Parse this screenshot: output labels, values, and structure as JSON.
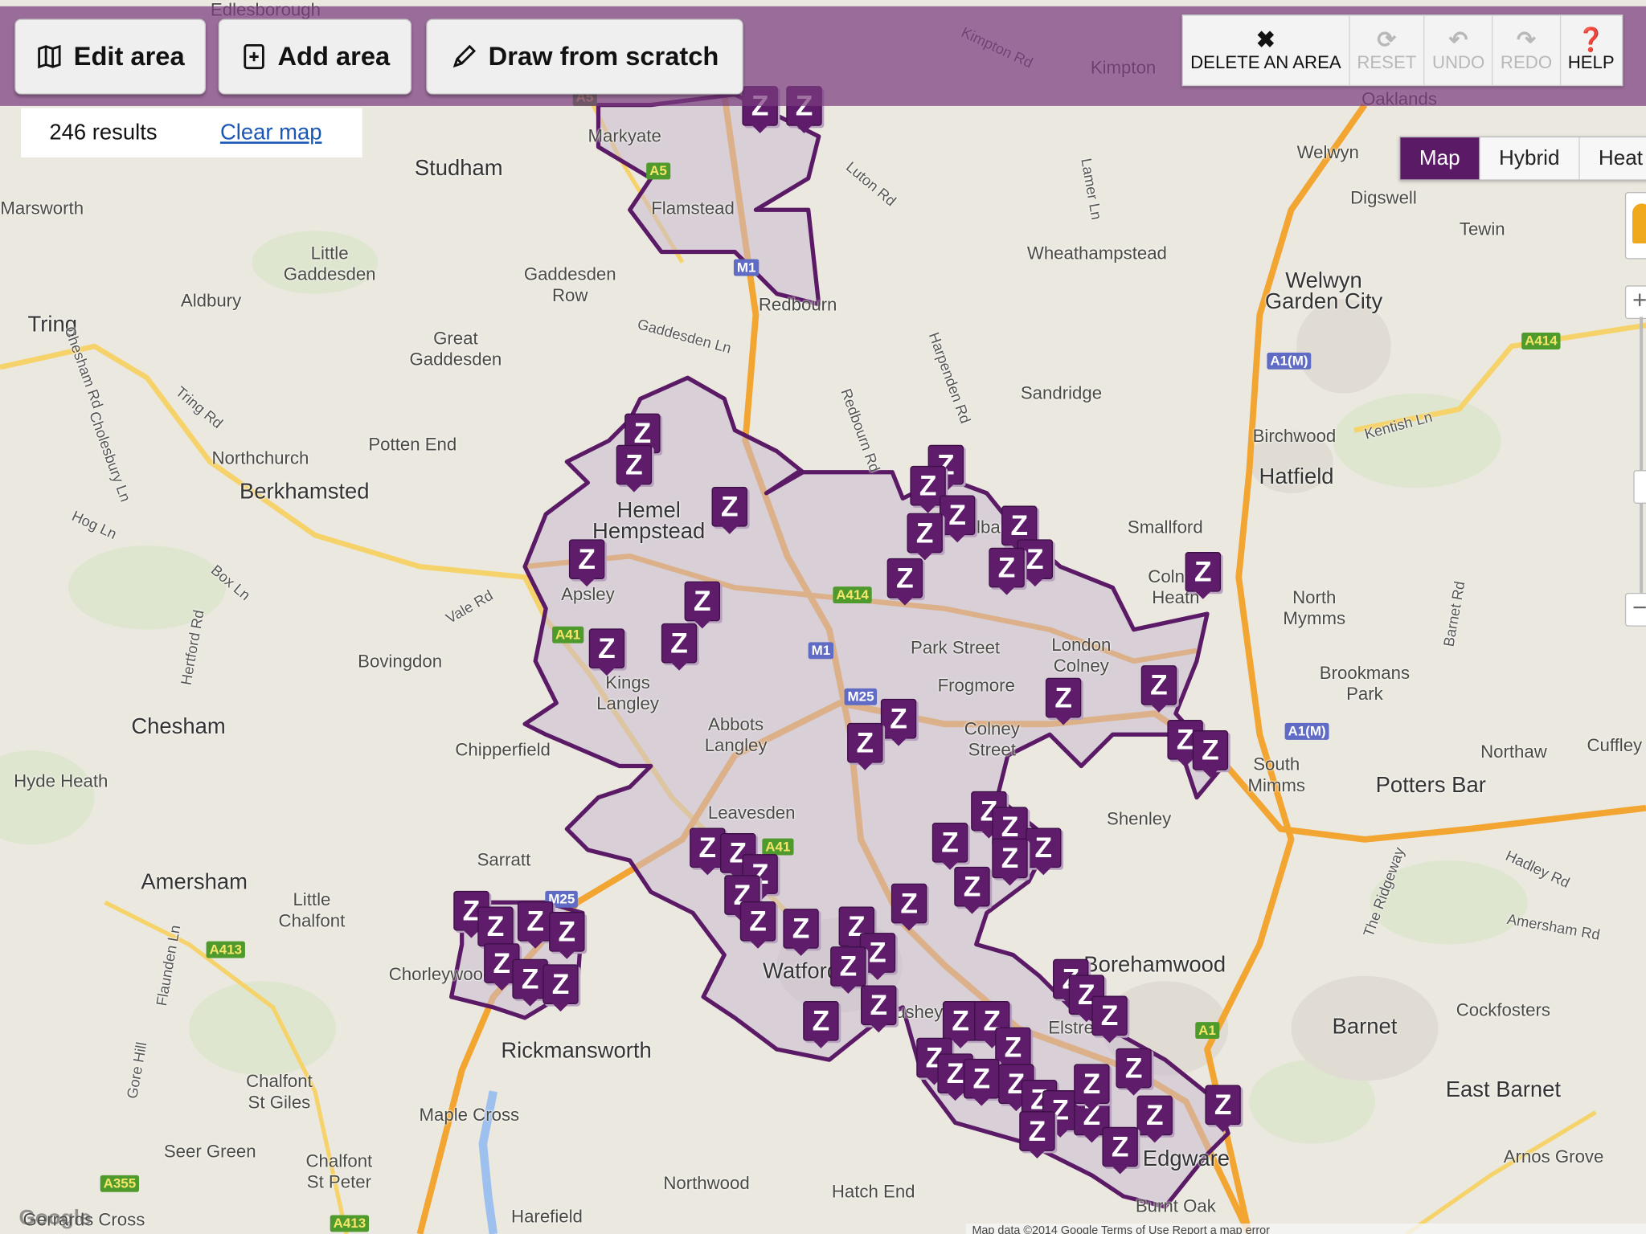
{
  "toolbar": {
    "edit_area": "Edit area",
    "add_area": "Add area",
    "draw_from_scratch": "Draw from scratch",
    "delete_area": "DELETE AN AREA",
    "reset": "RESET",
    "undo": "UNDO",
    "redo": "REDO",
    "help": "HELP",
    "icons": {
      "edit": "map-icon",
      "add": "plus-square-icon",
      "draw": "pencil-icon",
      "delete": "x-icon",
      "reset": "refresh-icon",
      "undo": "undo-icon",
      "redo": "redo-icon",
      "help": "question-circle-icon"
    }
  },
  "results": {
    "count": "246 results",
    "clear": "Clear map"
  },
  "map_type": {
    "options": [
      "Map",
      "Hybrid",
      "Heat"
    ],
    "selected": "Map"
  },
  "zoom_controls": {
    "in": "+",
    "out": "−"
  },
  "colors": {
    "brand": "#5a1a66",
    "toolbar_overlay": "#7a3c7e",
    "area_fill": "#c9b9cf",
    "area_stroke": "#5a1a66",
    "motorway": "#f3a531",
    "a_road": "#f6d36a"
  },
  "markers": {
    "label": "Z"
  },
  "map": {
    "labels": [
      "Edlesborough",
      "Marsworth",
      "Markyate",
      "Studham",
      "Flamstead",
      "Little\nGaddesden",
      "Aldbury",
      "Tring",
      "Gaddesden\nRow",
      "Redbourn",
      "Great\nGaddesden",
      "Potten End",
      "Northchurch",
      "Berkhamsted",
      "Hemel\nHempstead",
      "Apsley",
      "Bovingdon",
      "Kings\nLangley",
      "Chesham",
      "Chipperfield",
      "Abbots\nLangley",
      "Hyde Heath",
      "Leavesden",
      "Sarratt",
      "Amersham",
      "Little\nChalfont",
      "Chorleywood",
      "Watford",
      "Rickmansworth",
      "Maple Cross",
      "Chalfont\nSt Giles",
      "Seer Green",
      "Chalfont\nSt Peter",
      "Northwood",
      "Hatch End",
      "Harefield",
      "Gerrards Cross",
      "Kimpton",
      "Oaklands",
      "Welwyn",
      "Digswell",
      "Tewin",
      "Wheathampstead",
      "Welwyn\nGarden City",
      "Sandridge",
      "Birchwood",
      "Hatfield",
      "Smallford",
      "Colney\nHeath",
      "North\nMymms",
      "London\nColney",
      "Park Street",
      "Frogmore",
      "Colney\nStreet",
      "Brookmans\nPark",
      "South\nMimms",
      "Potters Bar",
      "Northaw",
      "Cuffley",
      "Shenley",
      "Borehamwood",
      "Elstree",
      "Bushey",
      "Barnet",
      "Cockfosters",
      "East Barnet",
      "Edgware",
      "Arnos Grove",
      "Burnt Oak",
      "St Albans"
    ],
    "roads": [
      "Kimpton Rd",
      "Luton Rd",
      "Lamer Ln",
      "Gaddesden Ln",
      "Redbourn Rd",
      "Harpenden Rd",
      "Tring Rd",
      "Chesham Rd",
      "Cholesbury Ln",
      "Hog Ln",
      "Box Ln",
      "Vale Rd",
      "Hertford Rd",
      "Kentish Ln",
      "Barnet Rd",
      "The Ridgeway",
      "Hadley Rd",
      "Amersham Rd",
      "Gore Hill",
      "Flaunden Ln"
    ],
    "shields": [
      "A5",
      "A5",
      "M1",
      "A414",
      "A41",
      "M1",
      "M25",
      "A41",
      "A413",
      "A355",
      "A413",
      "A1(M)",
      "A1(M)",
      "A414",
      "A1",
      "M25"
    ]
  },
  "attribution": "Map data ©2014 Google   Terms of Use   Report a map error",
  "logo": "Google"
}
